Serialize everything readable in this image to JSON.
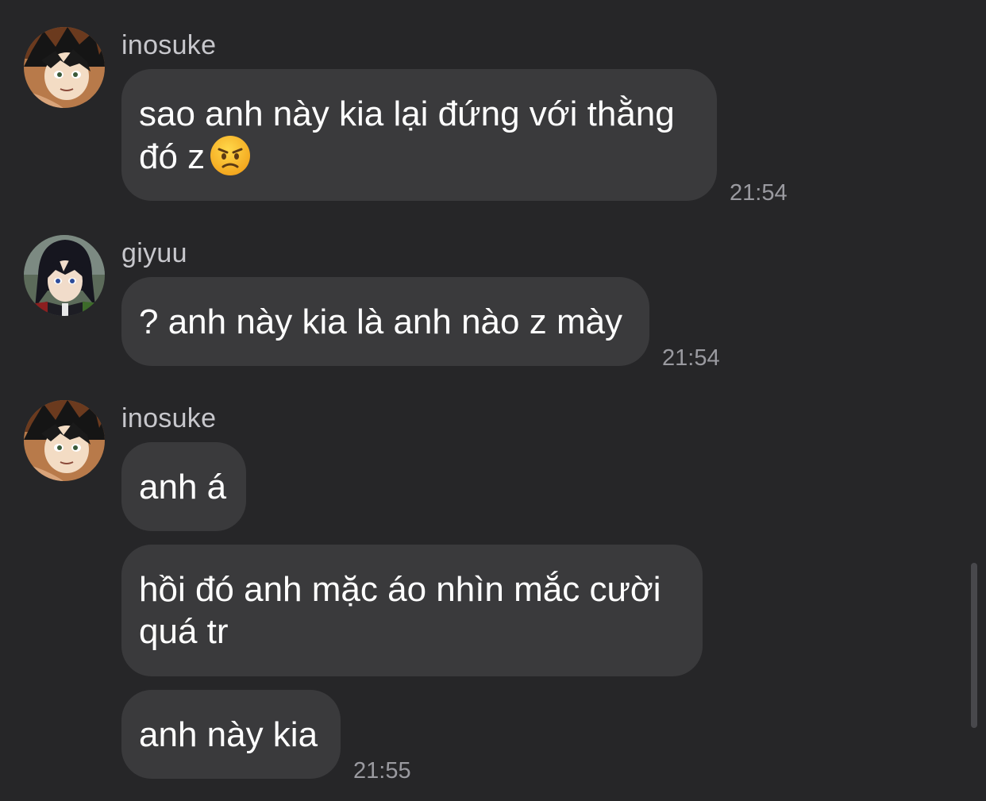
{
  "colors": {
    "background": "#262628",
    "bubble": "#3a3a3c",
    "sender_text": "#c7c7cc",
    "timestamp": "#9a9aa0",
    "message_text": "#ffffff"
  },
  "messages": [
    {
      "sender": "inosuke",
      "avatar": "inosuke-avatar",
      "bubbles": [
        {
          "text": "sao anh này kia lại đứng với thằng\nđó z",
          "emoji": "angry-face-emoji"
        }
      ],
      "time": "21:54"
    },
    {
      "sender": "giyuu",
      "avatar": "giyuu-avatar",
      "bubbles": [
        {
          "text": "? anh này kia là anh nào z mày"
        }
      ],
      "time": "21:54"
    },
    {
      "sender": "inosuke",
      "avatar": "inosuke-avatar",
      "bubbles": [
        {
          "text": "anh á"
        },
        {
          "text": "hồi đó anh mặc áo nhìn mắc cười\nquá tr"
        },
        {
          "text": "anh này kia"
        }
      ],
      "time": "21:55"
    }
  ]
}
